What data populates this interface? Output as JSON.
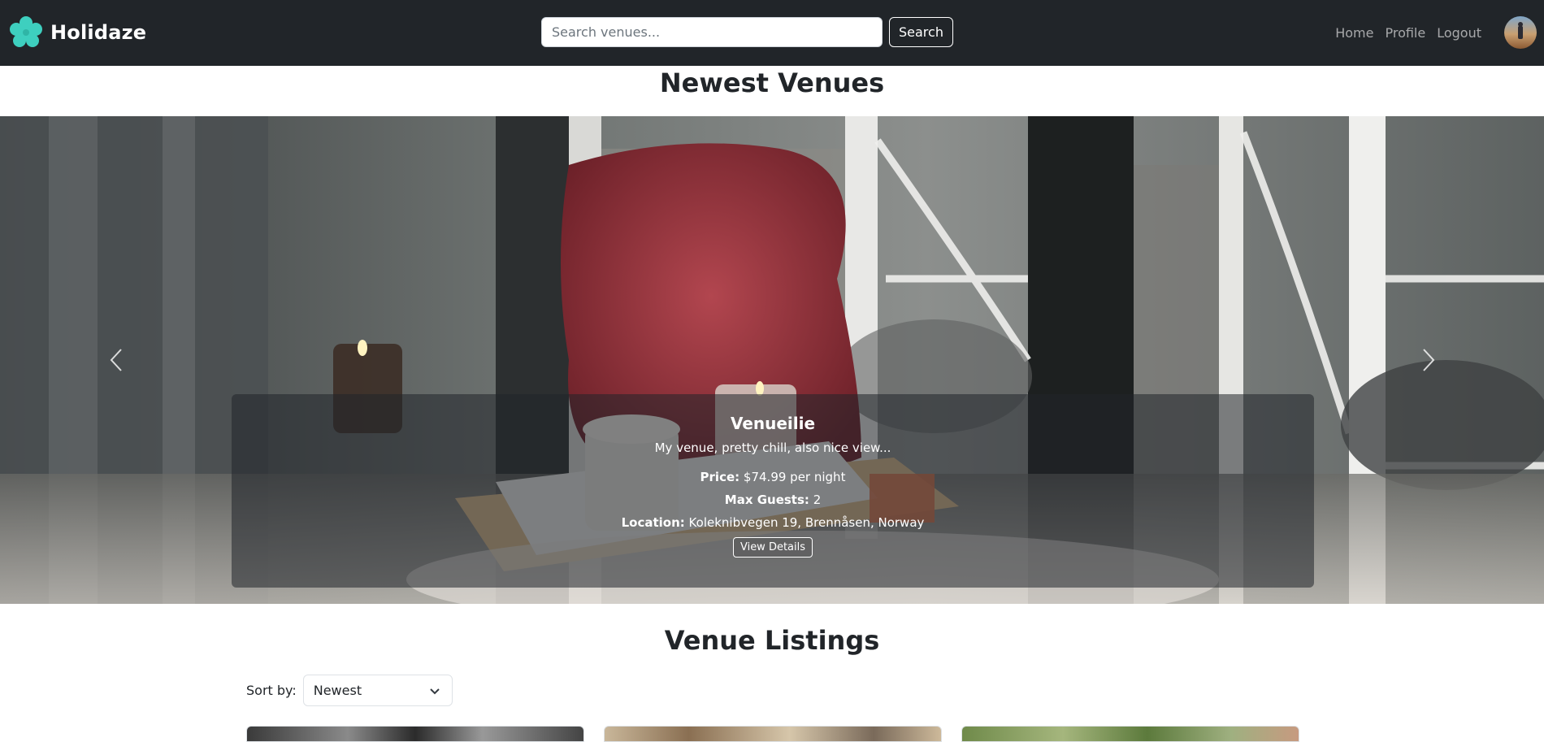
{
  "brand": {
    "name": "Holidaze",
    "logo_icon": "flower-icon",
    "logo_color": "#3ecfbf"
  },
  "search": {
    "placeholder": "Search venues...",
    "value": "",
    "button_label": "Search"
  },
  "nav": {
    "links": [
      "Home",
      "Profile",
      "Logout"
    ]
  },
  "sections": {
    "newest_title": "Newest Venues",
    "listings_title": "Venue Listings"
  },
  "carousel": {
    "prev_icon": "chevron-left-icon",
    "next_icon": "chevron-right-icon",
    "slide": {
      "title": "Venueilie",
      "description": "My venue, pretty chill, also nice view...",
      "price_label": "Price:",
      "price_value": "$74.99 per night",
      "guests_label": "Max Guests:",
      "guests_value": "2",
      "location_label": "Location:",
      "location_value": "Koleknibvegen 19, Brennåsen, Norway",
      "button_label": "View Details"
    }
  },
  "sort": {
    "label": "Sort by:",
    "selected": "Newest",
    "icon": "chevron-down-icon"
  },
  "colors": {
    "navbar": "#212529",
    "text": "#212529",
    "white": "#ffffff"
  }
}
